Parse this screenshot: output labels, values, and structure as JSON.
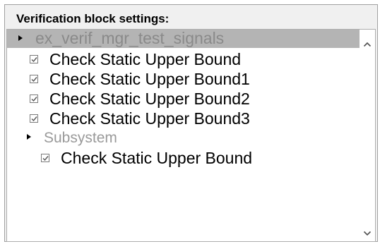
{
  "panel": {
    "title": "Verification block settings:"
  },
  "tree": {
    "items": [
      {
        "label": "ex_verif_mgr_test_signals",
        "type": "group",
        "level": 0,
        "selected": true
      },
      {
        "label": "Check Static Upper Bound",
        "type": "checkbox",
        "checked": true,
        "level": 1
      },
      {
        "label": "Check Static Upper Bound1",
        "type": "checkbox",
        "checked": true,
        "level": 1
      },
      {
        "label": "Check Static Upper Bound2",
        "type": "checkbox",
        "checked": true,
        "level": 1
      },
      {
        "label": "Check Static Upper Bound3",
        "type": "checkbox",
        "checked": true,
        "level": 1
      },
      {
        "label": "Subsystem",
        "type": "group",
        "level": 1
      },
      {
        "label": "Check Static Upper Bound",
        "type": "checkbox",
        "checked": true,
        "level": 2
      }
    ]
  },
  "scrollbar": {
    "up_icon": "chevron-up-icon",
    "down_icon": "chevron-down-icon"
  }
}
